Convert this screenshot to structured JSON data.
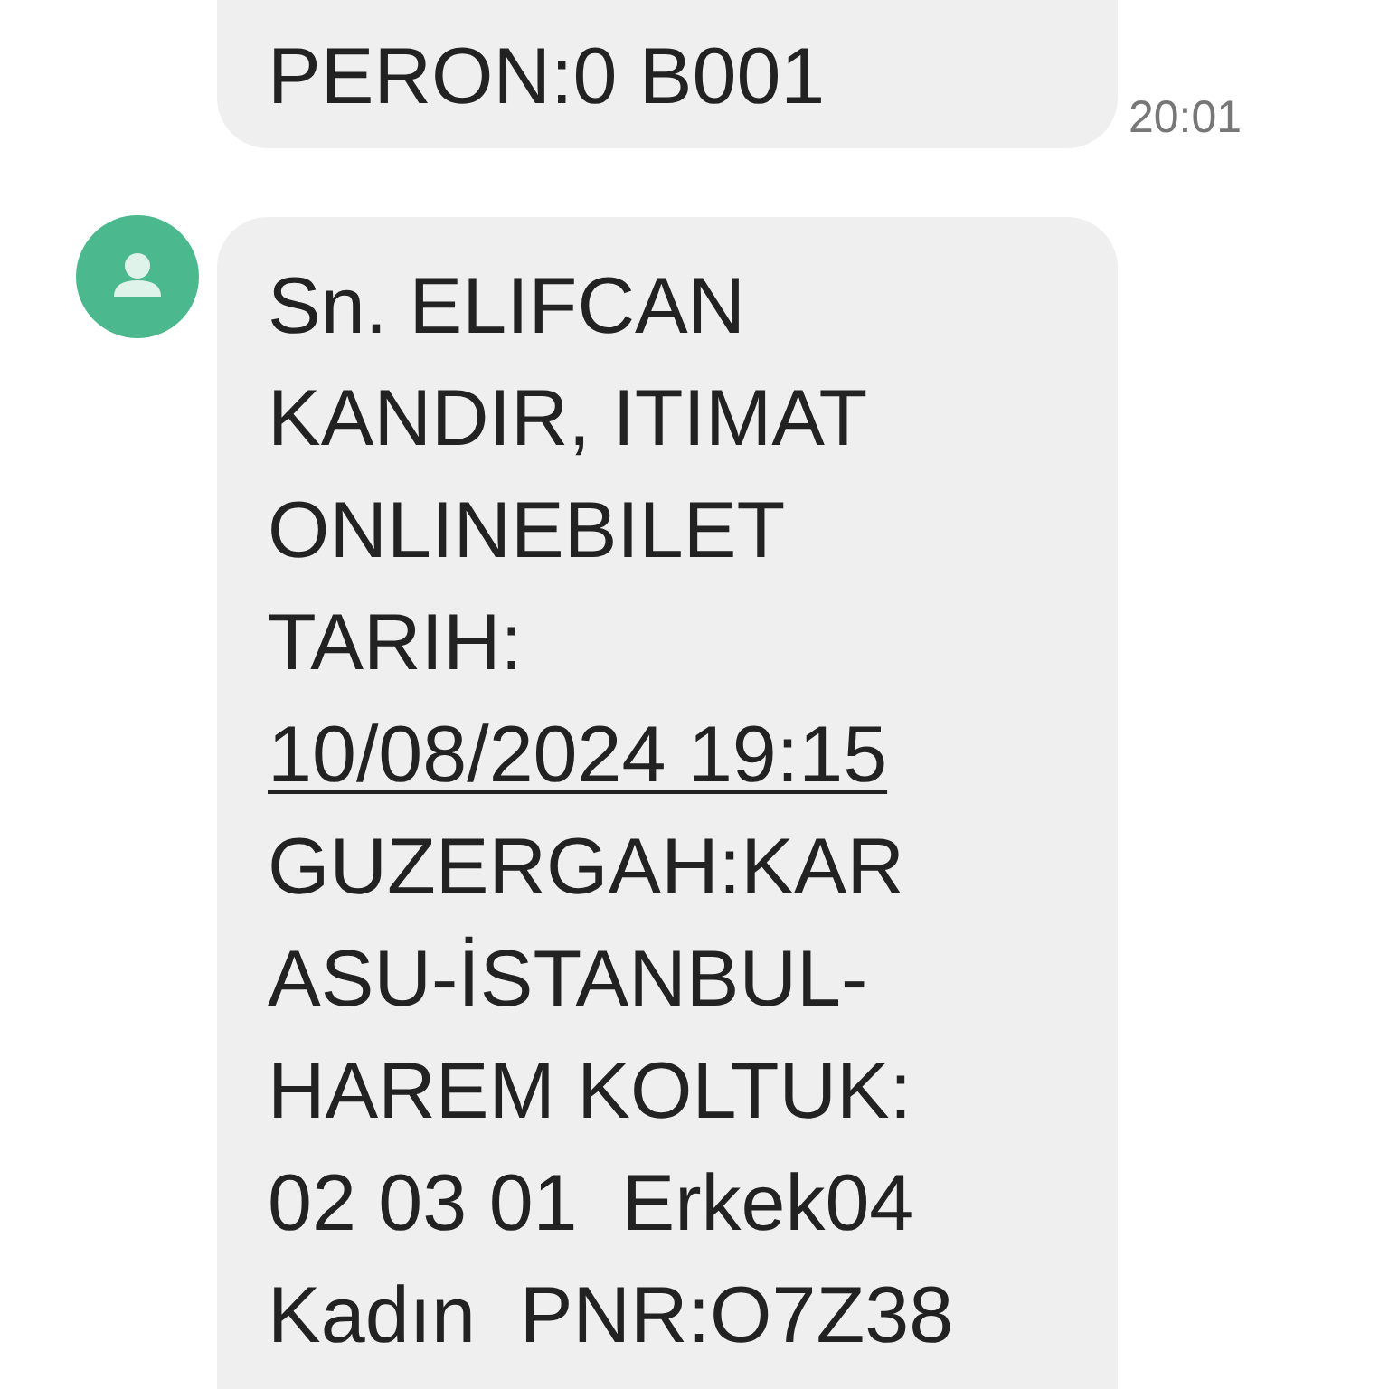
{
  "messages": [
    {
      "lines": [
        {
          "kind": "text",
          "text": "PERON:0 B001"
        }
      ],
      "time": "20:01",
      "avatar": false
    },
    {
      "lines": [
        {
          "kind": "text",
          "text": "Sn. ELIFCAN"
        },
        {
          "kind": "text",
          "text": "KANDIR, ITIMAT"
        },
        {
          "kind": "text",
          "text": "ONLINEBILET"
        },
        {
          "kind": "text",
          "text": "TARIH:"
        },
        {
          "kind": "link",
          "text": "10/08/2024 19:15"
        },
        {
          "kind": "text",
          "text": "GUZERGAH:KAR"
        },
        {
          "kind": "text",
          "text": "ASU-İSTANBUL-"
        },
        {
          "kind": "text",
          "text": "HAREM KOLTUK:"
        },
        {
          "kind": "text",
          "text": "02 03 01  Erkek04"
        },
        {
          "kind": "text",
          "text": "Kadın  PNR:O7Z38"
        }
      ],
      "avatar": true
    }
  ]
}
